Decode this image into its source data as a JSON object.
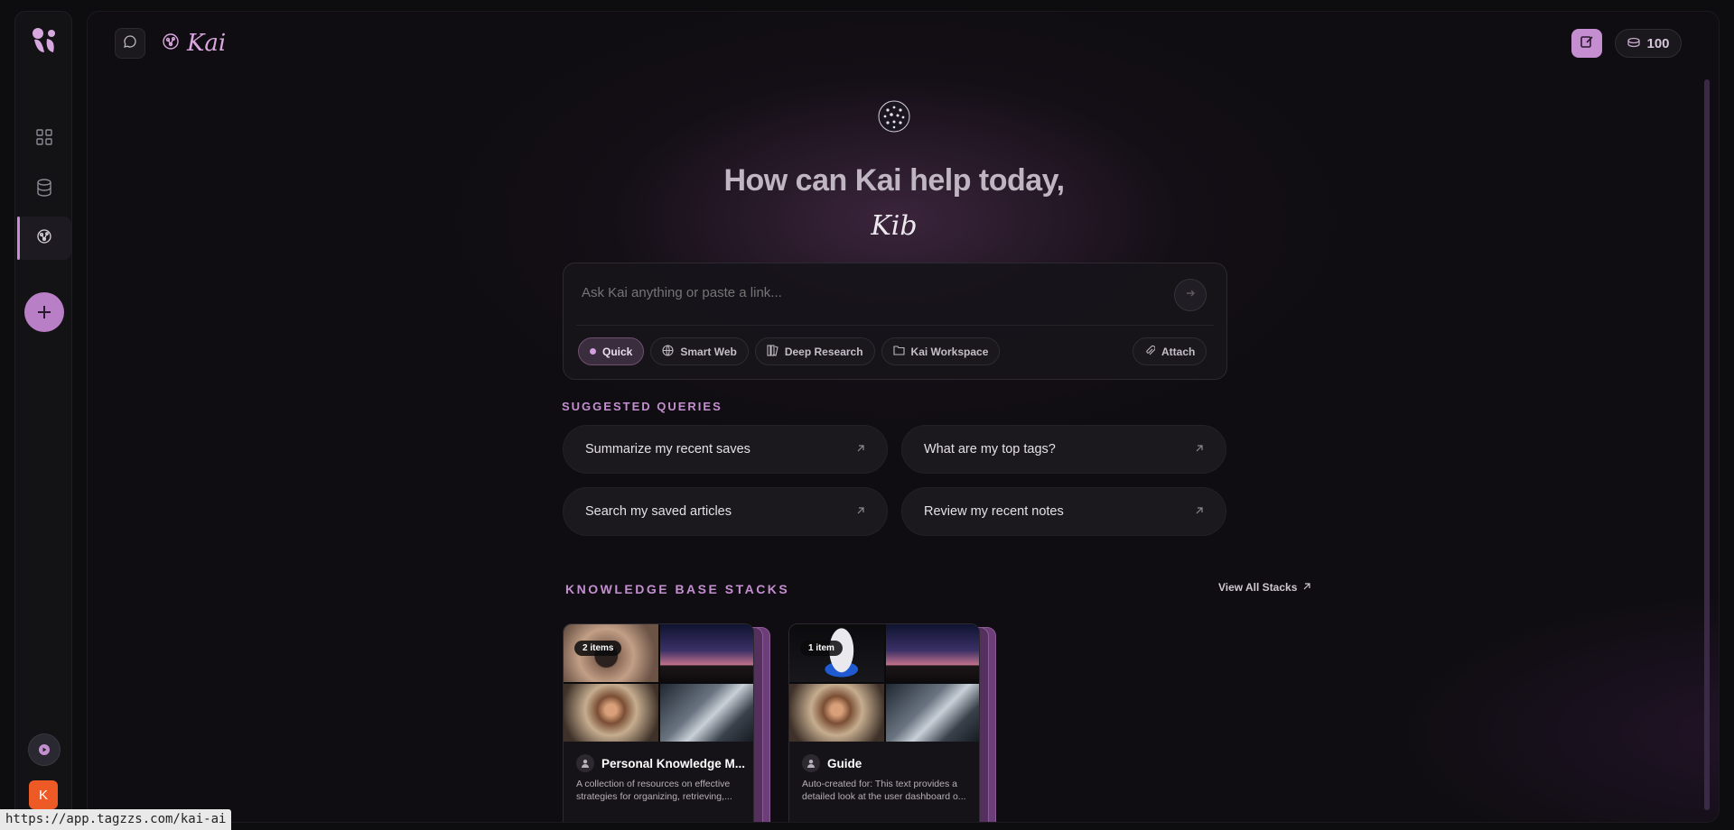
{
  "app": {
    "title": "Kai",
    "credits": "100",
    "user_initial": "K"
  },
  "hero": {
    "greeting": "How can Kai help today,",
    "name": "Kib"
  },
  "ask": {
    "placeholder": "Ask Kai anything or paste a link...",
    "modes": [
      "Quick",
      "Smart Web",
      "Deep Research",
      "Kai Workspace"
    ],
    "active_mode": "Quick",
    "attach_label": "Attach"
  },
  "suggested": {
    "heading": "SUGGESTED QUERIES",
    "items": [
      "Summarize my recent saves",
      "What are my top tags?",
      "Search my saved articles",
      "Review my recent notes"
    ]
  },
  "stacks": {
    "heading": "KNOWLEDGE BASE STACKS",
    "view_all": "View All Stacks",
    "items": [
      {
        "badge": "2 items",
        "title": "Personal Knowledge M...",
        "description": "A collection of resources on effective strategies for organizing, retrieving,..."
      },
      {
        "badge": "1 item",
        "title": "Guide",
        "description": "Auto-created for: This text provides a detailed look at the user dashboard o..."
      }
    ]
  },
  "status_url": "https://app.tagzzs.com/kai-ai",
  "colors": {
    "accent": "#c48fd0",
    "avatar": "#ee5a25",
    "background": "#0f0d11"
  }
}
